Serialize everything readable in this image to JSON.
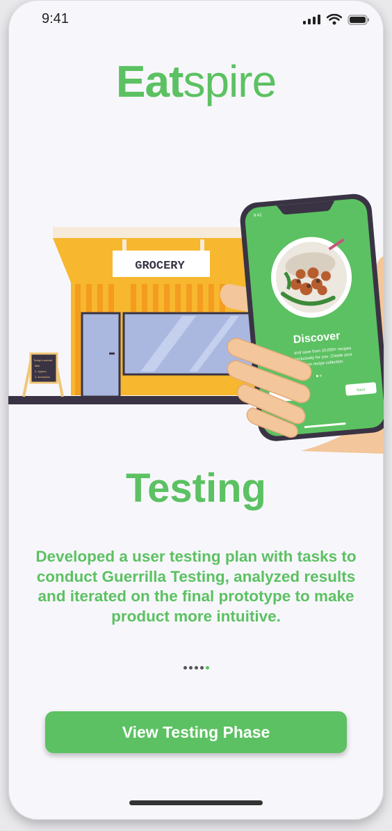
{
  "status_bar": {
    "time": "9:41"
  },
  "brand": {
    "bold": "Eat",
    "regular": "spire"
  },
  "illustration": {
    "store_sign": "GROCERY",
    "phone_time": "9:41",
    "phone_title": "Discover",
    "phone_subtitle_lines": [
      "and save from 10,000+ recipes",
      "exclusively for you. Create your",
      "own recipe collection"
    ],
    "phone_next": "Next",
    "board_lines": [
      "Today's special",
      "Milk",
      "2. Apples",
      "3. Avocados"
    ]
  },
  "content": {
    "title": "Testing",
    "description": "Developed a user testing plan with tasks to conduct Guerrilla Testing, analyzed results and iterated on the final prototype to make product more intuitive."
  },
  "pagination": {
    "count": 5,
    "active_index": 4
  },
  "cta": {
    "label": "View Testing Phase"
  },
  "colors": {
    "brand_green": "#5cc162",
    "store_yellow": "#f7b72e",
    "store_orange": "#f39c1f",
    "window_blue": "#aab8e0",
    "hand_skin": "#f3c79b",
    "ground": "#3a3344"
  }
}
